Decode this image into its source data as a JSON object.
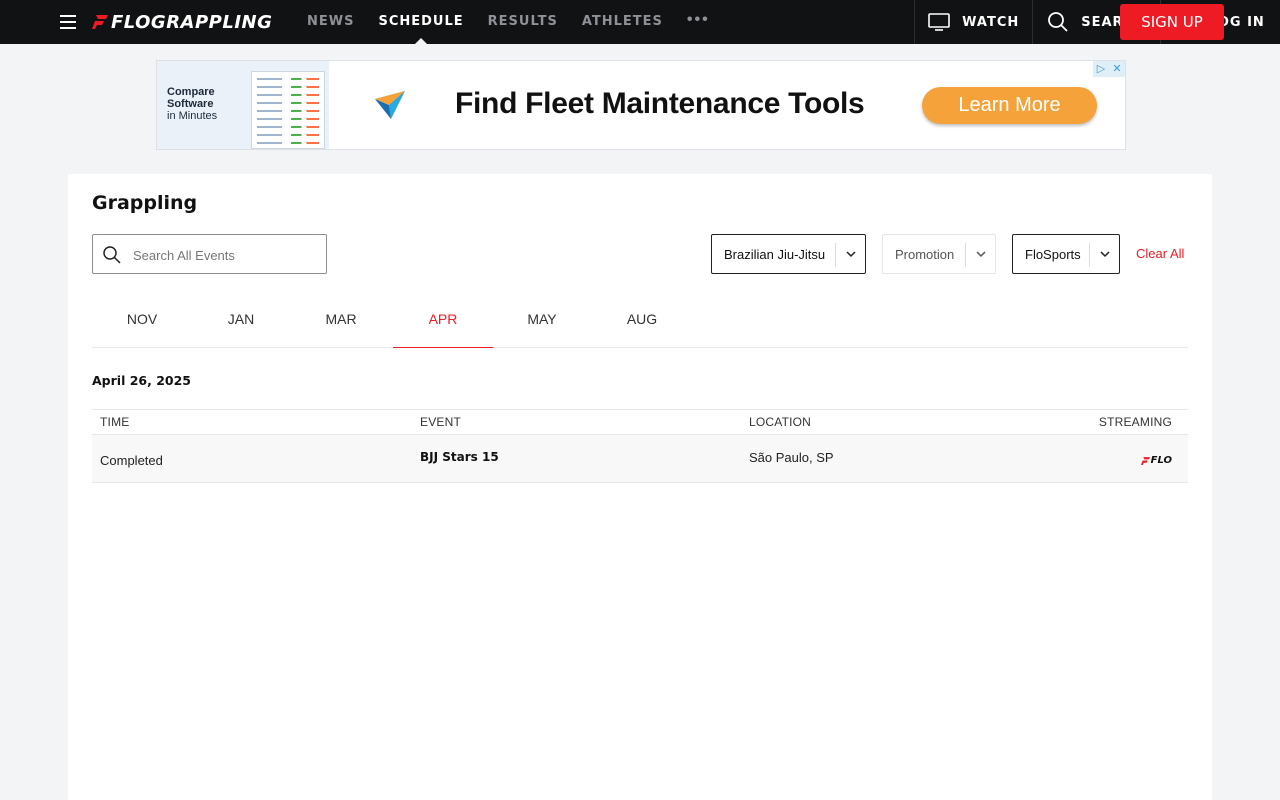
{
  "brand": {
    "logo_text": "FLOGRAPPLING",
    "accent": "#ee1b24"
  },
  "nav": {
    "items": [
      {
        "label": "NEWS",
        "active": false
      },
      {
        "label": "SCHEDULE",
        "active": true
      },
      {
        "label": "RESULTS",
        "active": false
      },
      {
        "label": "ATHLETES",
        "active": false
      }
    ],
    "more_label": "•••"
  },
  "header_actions": {
    "watch": "WATCH",
    "search": "SEARCH",
    "login": "LOG IN",
    "signup": "SIGN UP"
  },
  "ad": {
    "left_line1": "Compare",
    "left_line2": "Software",
    "left_line3": "in Minutes",
    "headline": "Find Fleet Maintenance Tools",
    "cta": "Learn More",
    "adchoices_icon": "▷",
    "close_icon": "✕"
  },
  "page": {
    "title": "Grappling",
    "search_placeholder": "Search All Events",
    "filters": [
      {
        "label": "Brazilian Jiu-Jitsu",
        "selected": true
      },
      {
        "label": "Promotion",
        "selected": false
      },
      {
        "label": "FloSports",
        "selected": true
      }
    ],
    "clear_all": "Clear All"
  },
  "months": [
    {
      "label": "NOV",
      "active": false
    },
    {
      "label": "JAN",
      "active": false
    },
    {
      "label": "MAR",
      "active": false
    },
    {
      "label": "APR",
      "active": true
    },
    {
      "label": "MAY",
      "active": false
    },
    {
      "label": "AUG",
      "active": false
    }
  ],
  "schedule": {
    "date": "April 26, 2025",
    "columns": {
      "time": "TIME",
      "event": "EVENT",
      "location": "LOCATION",
      "streaming": "STREAMING"
    },
    "rows": [
      {
        "time": "Completed",
        "event": "BJJ Stars 15",
        "location": "São Paulo, SP",
        "streaming_logo": "FLO"
      }
    ]
  }
}
